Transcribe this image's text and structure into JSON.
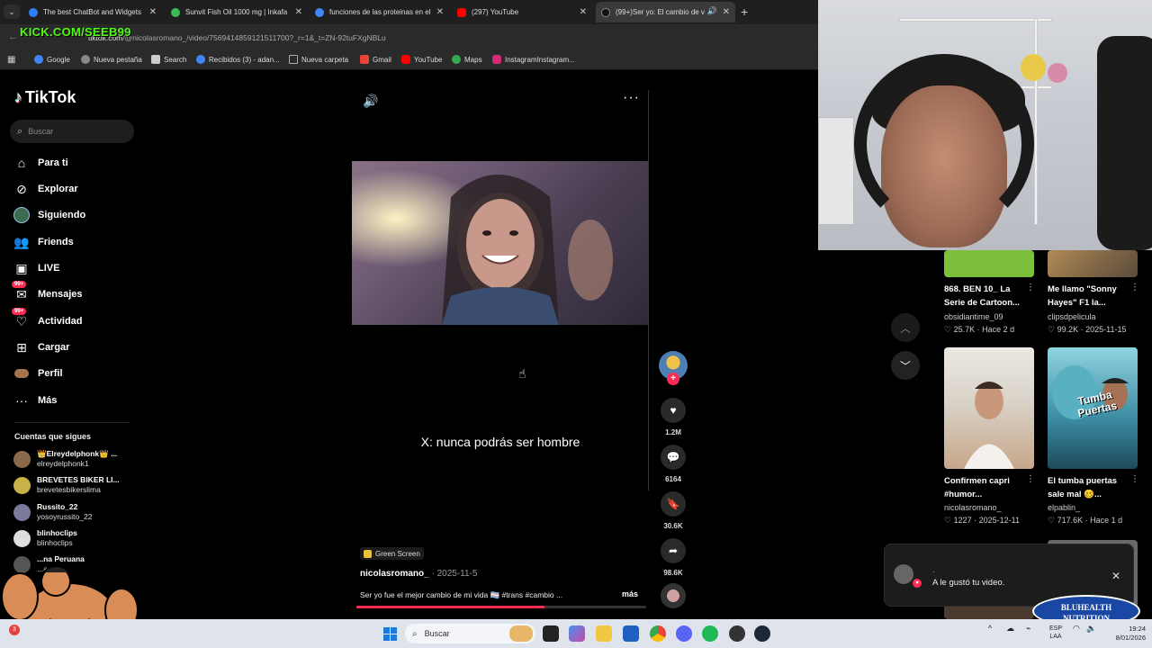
{
  "browser": {
    "tabs": [
      {
        "title": "The best ChatBot and Widgets",
        "color": "#2d7ff9"
      },
      {
        "title": "Sunvit Fish Oil 1000 mg | Inkafa",
        "color": "#3dbb5a"
      },
      {
        "title": "funciones de las proteinas en el",
        "color": "#4285f4"
      },
      {
        "title": "(297) YouTube",
        "color": "#ff0000"
      },
      {
        "title": "(99+)Ser yo: El cambio de v",
        "color": "#111111"
      }
    ],
    "new_tab": "+",
    "url_host": "tiktok.com",
    "url_path": "/@nicolasromano_/video/7569414859121511700?_r=1&_t=ZN-92tuFXgNBLu",
    "bookmarks": [
      {
        "label": "Google",
        "color": "#4285f4"
      },
      {
        "label": "Nueva pestaña",
        "color": "#888888"
      },
      {
        "label": "Search",
        "color": "#cccccc"
      },
      {
        "label": "Recibidos (3) - adan...",
        "color": "#4285f4"
      },
      {
        "label": "Nueva carpeta",
        "color": "#888888"
      },
      {
        "label": "Gmail",
        "color": "#ea4335"
      },
      {
        "label": "YouTube",
        "color": "#ff0000"
      },
      {
        "label": "Maps",
        "color": "#34a853"
      },
      {
        "label": "InstagramInstagram...",
        "color": "#d62976"
      }
    ]
  },
  "overlay": {
    "kick_text": "KICK.COM/SEEB99",
    "sponsor_line1": "BLUHEALTH",
    "sponsor_line2": "NUTRITION"
  },
  "tiktok": {
    "logo": "TikTok",
    "search_placeholder": "Buscar",
    "nav": [
      {
        "label": "Para ti",
        "icon": "home-icon"
      },
      {
        "label": "Explorar",
        "icon": "compass-icon"
      },
      {
        "label": "Siguiendo",
        "icon": "following-avatar-icon"
      },
      {
        "label": "Friends",
        "icon": "friends-icon"
      },
      {
        "label": "LIVE",
        "icon": "live-icon"
      },
      {
        "label": "Mensajes",
        "icon": "messages-icon",
        "badge": "99+"
      },
      {
        "label": "Actividad",
        "icon": "activity-icon",
        "badge": "99+"
      },
      {
        "label": "Cargar",
        "icon": "upload-icon"
      },
      {
        "label": "Perfil",
        "icon": "profile-icon"
      },
      {
        "label": "Más",
        "icon": "more-icon"
      }
    ],
    "following_header": "Cuentas que sigues",
    "following": [
      {
        "name": "👑Elreydelphonk👑 ...",
        "user": "elreydelphonk1",
        "color": "#8a6a4a"
      },
      {
        "name": "BREVETES BIKER LI...",
        "user": "brevetesbikerslima",
        "color": "#c9b047"
      },
      {
        "name": "Russito_22",
        "user": "yosoyrussito_22",
        "color": "#7a7a9a"
      },
      {
        "name": "blinhoclips",
        "user": "blinhoclips",
        "color": "#dddddd"
      },
      {
        "name": "...na Peruana",
        "user": "...a.p...",
        "color": "#555555"
      }
    ],
    "video": {
      "caption_overlay": "X: nunca podrás ser hombre",
      "effect_label": "Green Screen",
      "author": "nicolasromano_",
      "date": " · 2025-11-5",
      "description": "Ser yo fue el mejor cambio de mi vida 🏳️‍⚧️ #trans #cambio ...",
      "more": "más",
      "progress": 0.65
    },
    "actions": {
      "likes": "1.2M",
      "comments": "6164",
      "saves": "30.6K",
      "shares": "98.6K"
    },
    "recommendations": [
      {
        "title": "868. BEN 10_ La Serie de Cartoon...",
        "user": "obsidiantime_09",
        "likes": "25.7K",
        "when": "Hace 2 d",
        "color": "#7bbf3a"
      },
      {
        "title": "Me llamo \"Sonny Hayes\" F1 la...",
        "user": "clipsdpelicula",
        "likes": "99.2K",
        "when": "2025-11-15",
        "color": "#b08a55"
      },
      {
        "title": "Confirmen capri #humor...",
        "user": "nicolasromano_",
        "likes": "1227",
        "when": "2025-12-11",
        "color": "#d8d2c8"
      },
      {
        "title": "El tumba puertas sale mal 🥴...",
        "user": "elpablin_",
        "likes": "717.6K",
        "when": "Hace 1 d",
        "color": "#4a9bb0"
      }
    ],
    "thumb_text": "Tumba Puertas",
    "notification": {
      "dot": "·",
      "text": "A le gustó tu video."
    }
  },
  "taskbar": {
    "search_placeholder": "Buscar",
    "lang_top": "ESP",
    "lang_bottom": "LAA",
    "time": "19:24",
    "date": "8/01/2026"
  }
}
